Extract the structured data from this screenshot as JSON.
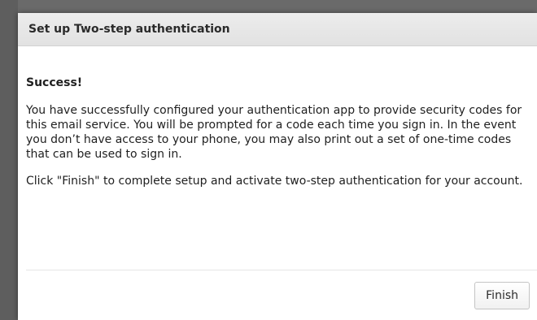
{
  "dialog": {
    "title": "Set up Two-step authentication",
    "heading": "Success!",
    "paragraphs": [
      "You have successfully configured your authentication app to provide security codes for this email service. You will be prompted for a code each time you sign in. In the event you don’t have access to your phone, you may also print out a set of one-time codes that can be used to sign in.",
      "Click \"Finish\" to complete setup and activate two-step authentication for your account."
    ],
    "finish_label": "Finish"
  },
  "colors": {
    "backdrop": "#6a6a6a",
    "header_bg": "#e6e6e6",
    "dialog_bg": "#ffffff"
  }
}
